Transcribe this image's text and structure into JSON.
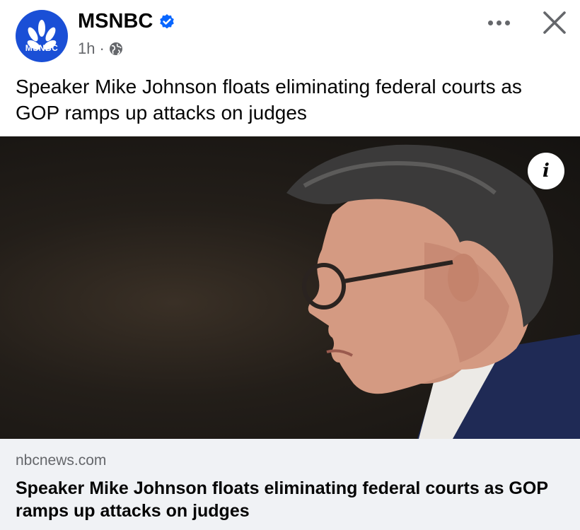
{
  "post": {
    "page_name": "MSNBC",
    "avatar_text": "MSNBC",
    "time": "1h",
    "separator": "·",
    "audience_icon": "globe-icon",
    "verified_icon": "verified-badge-icon",
    "caption": "Speaker Mike Johnson floats eliminating federal courts as GOP ramps up attacks on judges"
  },
  "actions": {
    "more_icon": "more-options-icon",
    "close_icon": "close-icon",
    "info_label": "i"
  },
  "link_preview": {
    "domain": "nbcnews.com",
    "title": "Speaker Mike Johnson floats eliminating federal courts as GOP ramps up attacks on judges"
  },
  "colors": {
    "brand_blue": "#1a4fd6",
    "verified_blue": "#0866ff",
    "secondary_text": "#65676b",
    "link_bg": "#f0f2f5"
  }
}
